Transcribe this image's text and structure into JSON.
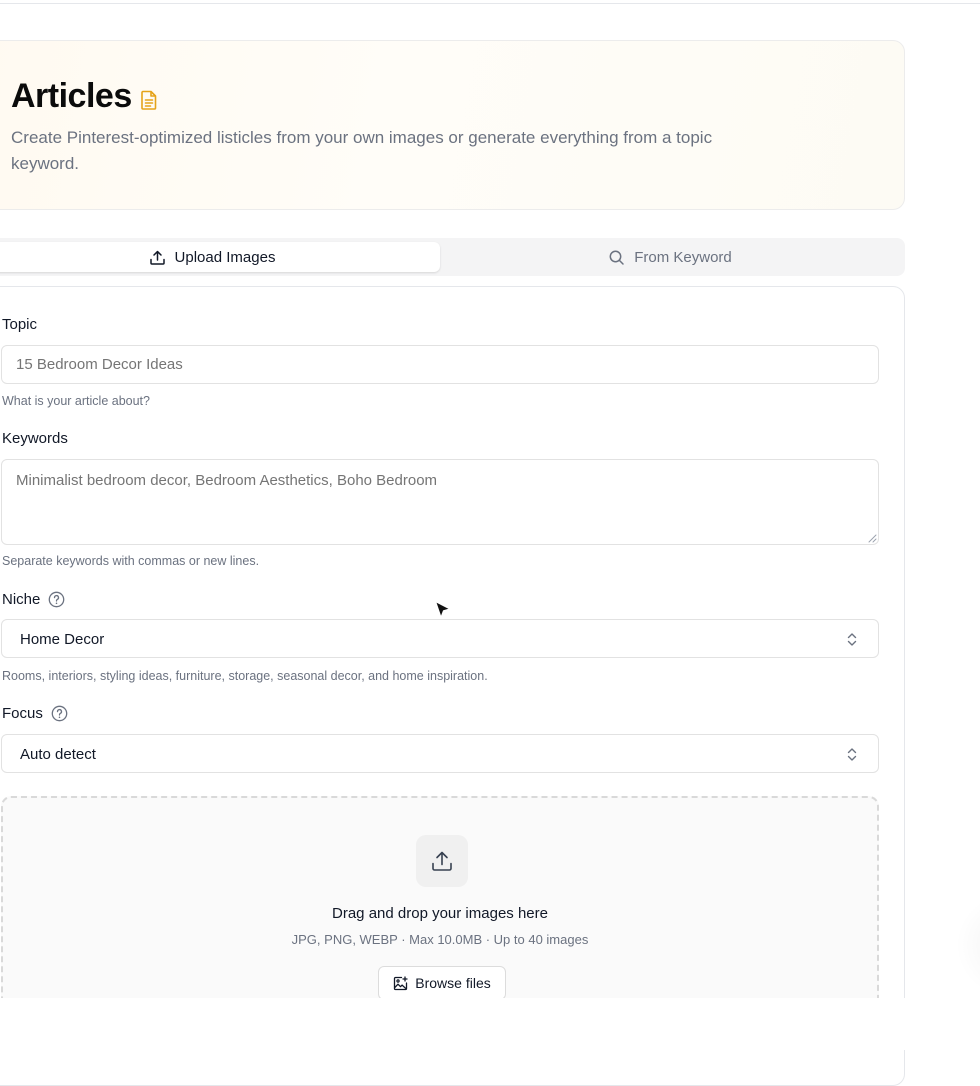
{
  "header": {
    "title": "Articles",
    "title_icon": "document-icon",
    "description": "Create Pinterest-optimized listicles from your own images or generate everything from a topic keyword."
  },
  "tabs": [
    {
      "label": "Upload Images",
      "icon": "upload-icon",
      "active": true
    },
    {
      "label": "From Keyword",
      "icon": "search-icon",
      "active": false
    }
  ],
  "form": {
    "topic": {
      "label": "Topic",
      "value": "",
      "placeholder": "15 Bedroom Decor Ideas",
      "hint": "What is your article about?"
    },
    "keywords": {
      "label": "Keywords",
      "value": "",
      "placeholder": "Minimalist bedroom decor, Bedroom Aesthetics, Boho Bedroom",
      "hint": "Separate keywords with commas or new lines."
    },
    "niche": {
      "label": "Niche",
      "selected": "Home Decor",
      "hint": "Rooms, interiors, styling ideas, furniture, storage, seasonal decor, and home inspiration."
    },
    "focus": {
      "label": "Focus",
      "selected": "Auto detect"
    }
  },
  "dropzone": {
    "title": "Drag and drop your images here",
    "subtitle": "JPG, PNG, WEBP · Max 10.0MB · Up to 40 images",
    "browse_label": "Browse files"
  },
  "colors": {
    "accent_icon": "#e5a31a",
    "border": "#e5e7eb",
    "muted_text": "#6b7280",
    "tab_bg": "#f4f4f5"
  }
}
